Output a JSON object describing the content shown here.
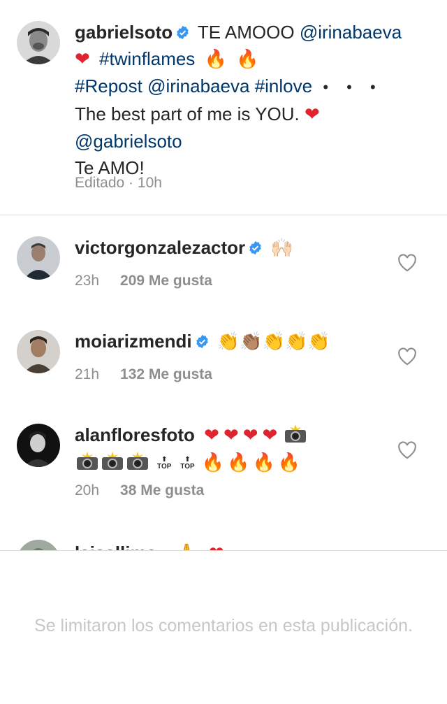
{
  "post": {
    "author": "gabrielsoto",
    "caption_text_1": " TE AMOOO ",
    "caption_mention_1": "@irinabaeva",
    "caption_hashtag_1": "#twinflames",
    "caption_hashtag_2": "#Repost",
    "caption_mention_2": "@irinabaeva",
    "caption_hashtag_3": "#inlove",
    "caption_more": "• • •",
    "caption_line_3": "The best part of me is YOU.",
    "caption_mention_3": "@gabrielsoto",
    "caption_line_5": "Te AMO!",
    "meta": "Editado · 10h"
  },
  "comments": [
    {
      "username": "victorgonzalezactor",
      "verified": true,
      "text": "🙌🏻",
      "time": "23h",
      "likes": "209 Me gusta"
    },
    {
      "username": "moiarizmendi",
      "verified": true,
      "text": "👏👏🏽👏👏👏",
      "time": "21h",
      "likes": "132 Me gusta"
    },
    {
      "username": "alanflores foto",
      "display_username": "alanfloresfoto",
      "verified": false,
      "text_line_1": "❤❤❤❤",
      "text_line_2_tops": [
        "TOP",
        "TOP"
      ],
      "time": "20h",
      "likes": "38 Me gusta"
    },
    {
      "username": "laisallima",
      "partial": true
    }
  ],
  "footer": {
    "limit_note": "Se limitaron los comentarios en esta publicación."
  },
  "colors": {
    "link": "#00376b",
    "meta": "#8e8e8e",
    "heart": "#e0242f",
    "verified": "#3897f0",
    "divider": "#dbdbdb",
    "note": "#c7c7c7"
  },
  "icons": [
    "verified-badge-icon",
    "heart-outline-icon",
    "camera-flash-icon",
    "fire-icon",
    "red-heart-icon"
  ]
}
